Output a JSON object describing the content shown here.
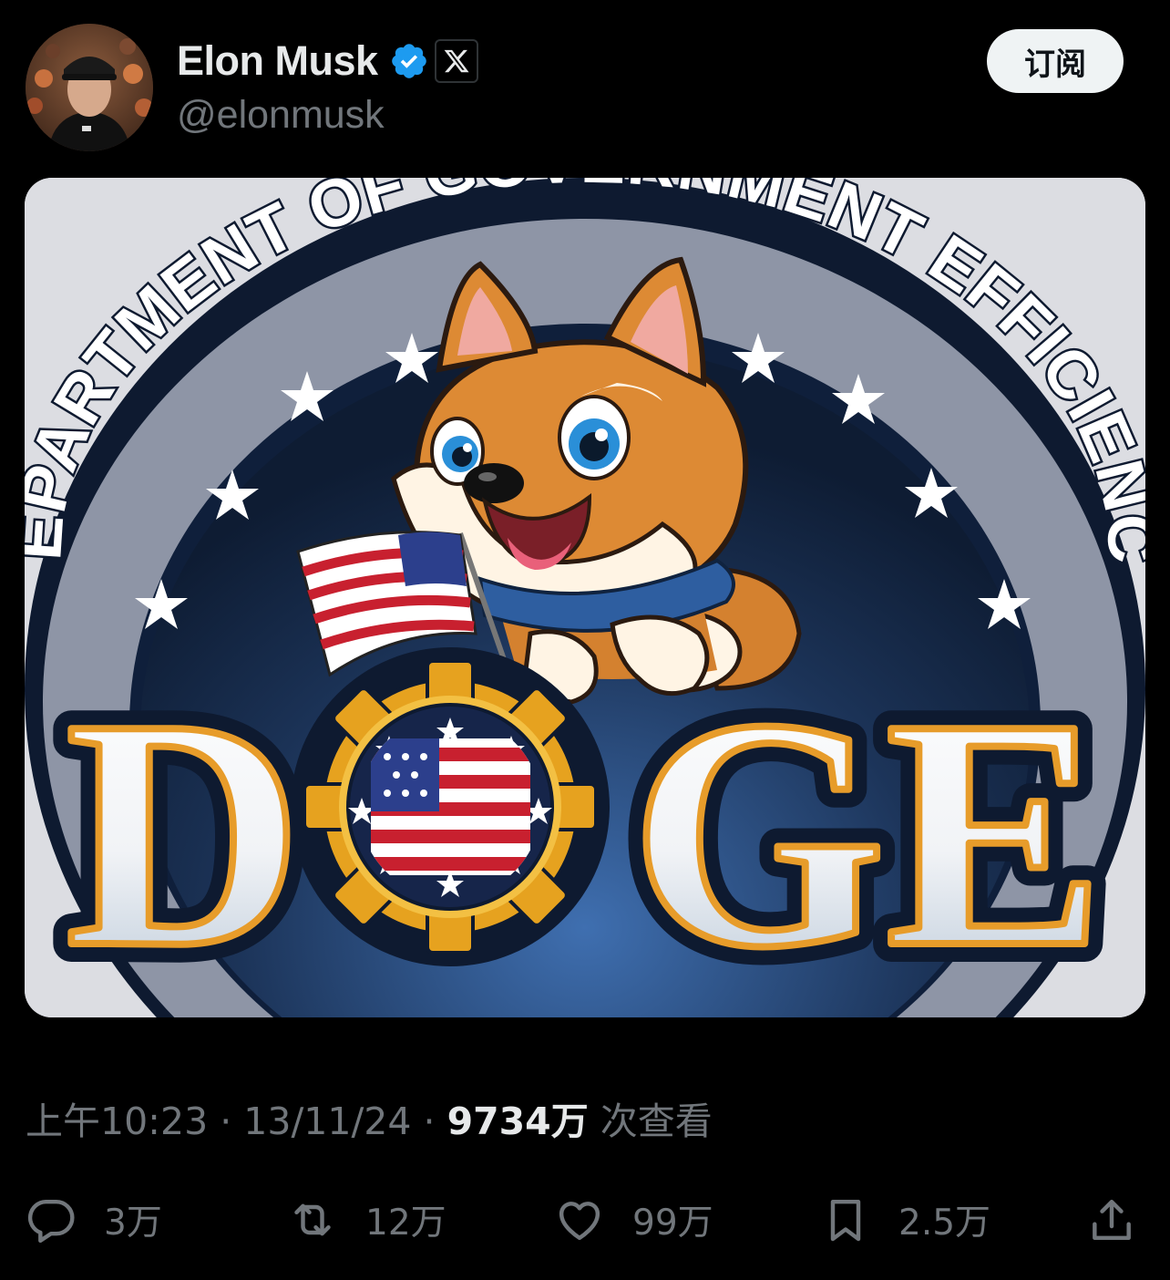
{
  "tweet": {
    "author_name": "Elon Musk",
    "handle": "@elonmusk",
    "subscribe_label": "订阅",
    "time": "上午10:23",
    "date": "13/11/24",
    "separator": "·",
    "views": "9734万",
    "views_suffix": "次查看"
  },
  "image": {
    "arc_text": "DEPARTMENT OF GOVERNMENT EFFICIENCY",
    "big_text_left": "D",
    "big_text_right": "GE"
  },
  "actions": {
    "replies": "3万",
    "reposts": "12万",
    "likes": "99万",
    "bookmarks": "2.5万"
  },
  "colors": {
    "background": "#000000",
    "verified": "#1d9bf0",
    "muted": "#71767b",
    "text": "#e7e9ea"
  }
}
